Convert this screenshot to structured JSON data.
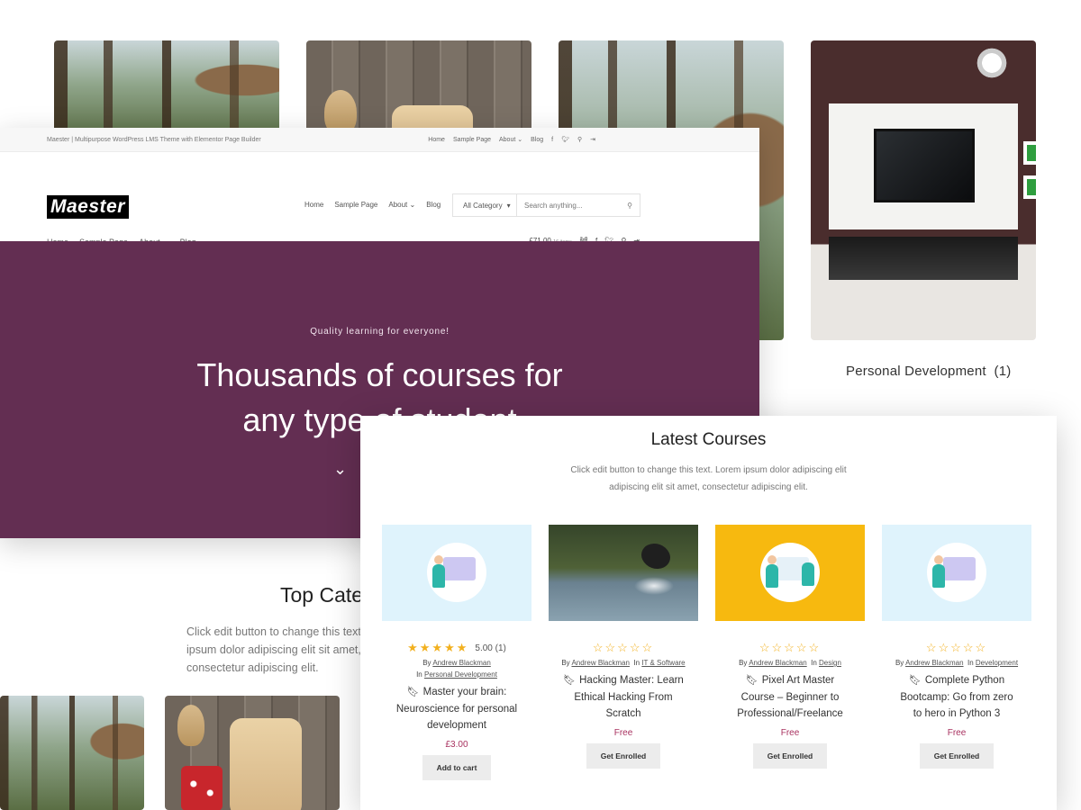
{
  "categories": {
    "personal_development_label": "Personal Development",
    "personal_development_count": "(1)"
  },
  "site": {
    "topbar_title": "Maester | Multipurpose WordPress LMS Theme with Elementor Page Builder",
    "topbar_menu": [
      "Home",
      "Sample Page",
      "About",
      "Blog"
    ],
    "logo": "Maester",
    "main_nav": [
      "Home",
      "Sample Page",
      "About",
      "Blog"
    ],
    "search": {
      "category": "All Category",
      "placeholder": "Search anything..."
    },
    "sub_nav": [
      "Home",
      "Sample Page",
      "About",
      "Blog"
    ],
    "cart": {
      "total": "£71.00",
      "items": "16 items"
    },
    "hero": {
      "tagline": "Quality learning for everyone!",
      "heading_line1": "Thousands of courses for",
      "heading_line2": "any type of student"
    },
    "top_categories": {
      "title": "Top Categories",
      "desc": "Click edit button to change this text. Lorem ipsum dolor adipiscing elit sit amet, consectetur adipiscing elit."
    }
  },
  "latest_courses": {
    "title": "Latest Courses",
    "desc_line1": "Click edit button to change this text. Lorem ipsum dolor adipiscing elit",
    "desc_line2": "adipiscing elit sit amet, consectetur adipiscing elit.",
    "courses": [
      {
        "rating": "5.00 (1)",
        "stars_filled": 5,
        "author": "Andrew Blackman",
        "category": "Personal Development",
        "title": "Master your brain: Neuroscience for personal development",
        "price": "£3.00",
        "button": "Add to cart"
      },
      {
        "rating": "",
        "stars_filled": 0,
        "author": "Andrew Blackman",
        "category": "IT & Software",
        "title": "Hacking Master: Learn Ethical Hacking From Scratch",
        "price": "Free",
        "button": "Get Enrolled"
      },
      {
        "rating": "",
        "stars_filled": 0,
        "author": "Andrew Blackman",
        "category": "Design",
        "title": "Pixel Art Master Course – Beginner to Professional/Freelance",
        "price": "Free",
        "button": "Get Enrolled"
      },
      {
        "rating": "",
        "stars_filled": 0,
        "author": "Andrew Blackman",
        "category": "Development",
        "title": "Complete Python Bootcamp: Go from zero to hero in Python 3",
        "price": "Free",
        "button": "Get Enrolled"
      }
    ]
  },
  "labels": {
    "by": "By",
    "in": "In"
  }
}
